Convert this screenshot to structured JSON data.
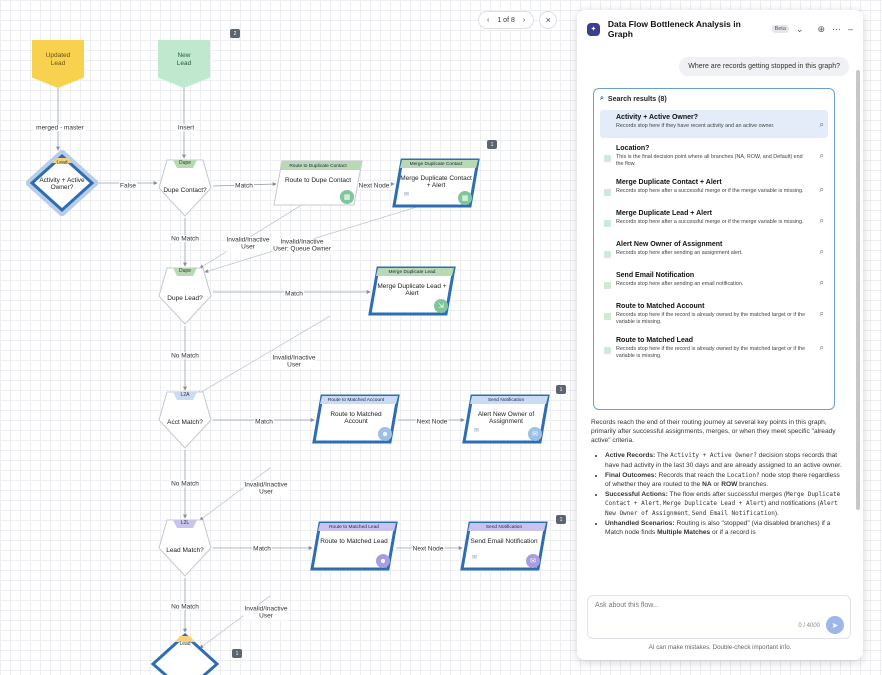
{
  "canvas": {
    "start_nodes": [
      {
        "id": "updated",
        "label": "Updated\nLead"
      },
      {
        "id": "new",
        "label": "New\nLead"
      }
    ],
    "decisions": [
      {
        "id": "activity",
        "tag": "Lead",
        "label": "Activity + Active\nOwner?"
      },
      {
        "id": "dupe_contact",
        "tag": "Dupe",
        "label": "Dupe Contact?"
      },
      {
        "id": "dupe_lead",
        "tag": "Dupe",
        "label": "Dupe Lead?"
      },
      {
        "id": "acct",
        "tag": "L2A",
        "label": "Acct Match?"
      },
      {
        "id": "lead",
        "tag": "L2L",
        "label": "Lead Match?"
      },
      {
        "id": "bottom",
        "tag": "Lead",
        "label": ""
      }
    ],
    "actions": [
      {
        "id": "route_dupe",
        "head": "Route to Duplicate Contact",
        "label": "Route to Dupe Contact",
        "icon": "calendar-icon"
      },
      {
        "id": "merge_contact",
        "head": "Merge Duplicate Contact",
        "label": "Merge Duplicate Contact\n+ Alert",
        "icon": "calendar-icon"
      },
      {
        "id": "merge_lead",
        "head": "Merge Duplicate Lead",
        "label": "Merge Duplicate Lead +\nAlert",
        "icon": "merge-icon"
      },
      {
        "id": "route_acct",
        "head": "Route to Matched Account",
        "label": "Route to Matched\nAccount",
        "icon": "people-icon"
      },
      {
        "id": "alert_owner",
        "head": "Send Notification",
        "label": "Alert New Owner of\nAssignment",
        "icon": "mail-icon"
      },
      {
        "id": "route_lead",
        "head": "Route to Matched Lead",
        "label": "Route to Matched Lead",
        "icon": "people-icon"
      },
      {
        "id": "send_email",
        "head": "Send Notification",
        "label": "Send Email Notification",
        "icon": "mail-icon"
      }
    ],
    "edge_labels": {
      "merged_master": "merged - master",
      "insert": "Insert",
      "false": "False",
      "match1": "Match",
      "next1": "Next Node",
      "nomatch1": "No Match",
      "invalid1": "Invalid/Inactive\nUser",
      "invalid_queue": "Invalid/Inactive\nUser: Queue Owner",
      "match2": "Match",
      "nomatch2": "No Match",
      "invalid2": "Invalid/Inactive\nUser",
      "match3": "Match",
      "next3": "Next Node",
      "nomatch3": "No Match",
      "invalid3": "Invalid/Inactive\nUser",
      "match4": "Match",
      "next4": "Next Node",
      "nomatch4": "No Match",
      "invalid4": "Invalid/Inactive\nUser"
    },
    "comment_counts": {
      "c1": "2",
      "c2": "1",
      "c3": "1",
      "c4": "1",
      "c5": "1"
    }
  },
  "pager": {
    "label": "1 of 8",
    "prev": "‹",
    "next": "›",
    "close": "×"
  },
  "panel": {
    "title": "Data Flow Bottleneck Analysis in Graph",
    "beta": "Beta",
    "user_message": "Where are records getting stopped in this graph?",
    "results_title": "Search results (8)",
    "results": [
      {
        "title": "Activity + Active Owner?",
        "desc": "Records stop here if they have recent activity and an active owner.",
        "active": true
      },
      {
        "title": "Location?",
        "desc": "This is the final decision point where all branches (NA, ROW, and Default) end the flow.",
        "active": false
      },
      {
        "title": "Merge Duplicate Contact + Alert",
        "desc": "Records stop here after a successful merge or if the merge variable is missing.",
        "active": false
      },
      {
        "title": "Merge Duplicate Lead + Alert",
        "desc": "Records stop here after a successful merge or if the merge variable is missing.",
        "active": false
      },
      {
        "title": "Alert New Owner of Assignment",
        "desc": "Records stop here after sending an assignment alert.",
        "active": false
      },
      {
        "title": "Send Email Notification",
        "desc": "Records stop here after sending an email notification.",
        "active": false
      },
      {
        "title": "Route to Matched Account",
        "desc": "Records stop here if the record is already owned by the matched target or if the variable is missing.",
        "active": false
      },
      {
        "title": "Route to Matched Lead",
        "desc": "Records stop here if the record is already owned by the matched target or if the variable is missing.",
        "active": false
      }
    ],
    "answer_intro": "Records reach the end of their routing journey at several key points in this graph, primarily after successful assignments, merges, or when they meet specific \"already active\" criteria.",
    "answer_bullets": {
      "b1_label": "Active Records:",
      "b1_pre": " The ",
      "b1_code": "Activity + Active Owner?",
      "b1_post": " decision stops records that have had activity in the last 30 days and are already assigned to an active owner.",
      "b2_label": "Final Outcomes:",
      "b2_pre": " Records that reach the ",
      "b2_code": "Location?",
      "b2_mid": " node stop there regardless of whether they are routed to the ",
      "b2_na": "NA",
      "b2_or": " or ",
      "b2_row": "ROW",
      "b2_post": " branches.",
      "b3_label": "Successful Actions:",
      "b3_pre": " The flow ends after successful merges (",
      "b3_code1": "Merge Duplicate Contact + Alert",
      "b3_sep": ", ",
      "b3_code2": "Merge Duplicate Lead + Alert",
      "b3_mid": ") and notifications (",
      "b3_code3": "Alert New Owner of Assignment",
      "b3_sep2": ", ",
      "b3_code4": "Send Email Notification",
      "b3_post": ").",
      "b4_label": "Unhandled Scenarios:",
      "b4_pre": " Routing is also \"stopped\" (via disabled branches) if a Match node finds ",
      "b4_bold": "Multiple Matches",
      "b4_post": " or if a record is"
    },
    "input_placeholder": "Ask about this flow...",
    "char_count": "0 / 4000",
    "disclaimer": "AI can make mistakes. Double-check important info."
  },
  "colors": {
    "accent": "#2f6db3",
    "decision_border": "#2f6db3",
    "updated_lead": "#f8d24f",
    "new_lead": "#bfe8cf"
  }
}
